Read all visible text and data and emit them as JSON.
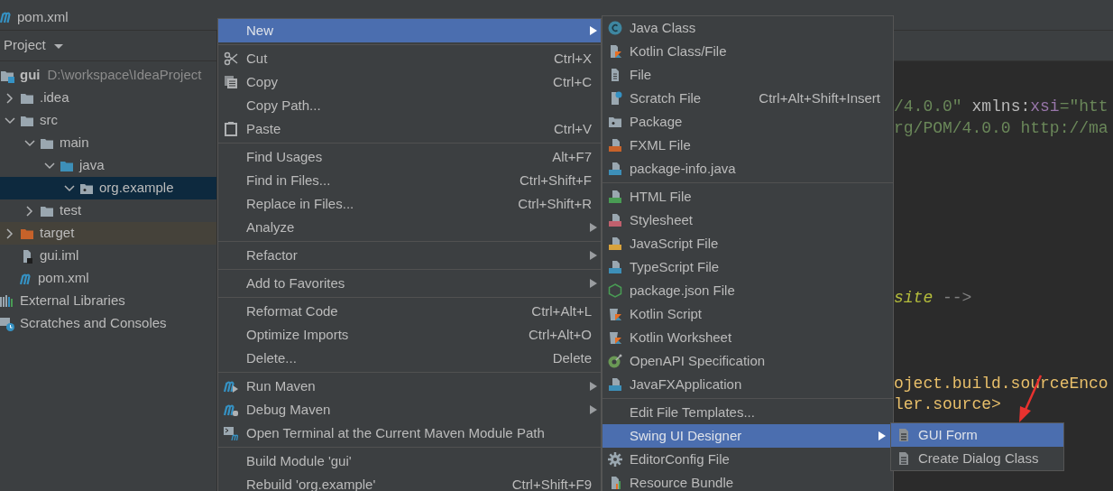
{
  "editor_tab": {
    "title": "pom.xml"
  },
  "project_panel": {
    "title": "Project",
    "tree": [
      {
        "label": "gui",
        "detail": "D:\\workspace\\IdeaProject",
        "kind": "module",
        "expanded": true,
        "selected": false,
        "children": [
          {
            "label": ".idea",
            "kind": "folder",
            "expanded": false,
            "selected": false
          },
          {
            "label": "src",
            "kind": "folder",
            "expanded": true,
            "selected": false,
            "children": [
              {
                "label": "main",
                "kind": "folder",
                "expanded": true,
                "selected": false,
                "children": [
                  {
                    "label": "java",
                    "kind": "source-folder",
                    "expanded": true,
                    "selected": false,
                    "children": [
                      {
                        "label": "org.example",
                        "kind": "package",
                        "expanded": true,
                        "selected": true
                      }
                    ]
                  }
                ]
              },
              {
                "label": "test",
                "kind": "folder",
                "expanded": false,
                "selected": false
              }
            ]
          },
          {
            "label": "target",
            "kind": "excluded-folder",
            "expanded": false,
            "selected": false
          },
          {
            "label": "gui.iml",
            "kind": "iml-file",
            "selected": false
          },
          {
            "label": "pom.xml",
            "kind": "maven-file",
            "selected": false
          }
        ]
      },
      {
        "label": "External Libraries",
        "kind": "libraries",
        "selected": false
      },
      {
        "label": "Scratches and Consoles",
        "kind": "scratches",
        "selected": false
      }
    ]
  },
  "code_lines": [
    {
      "segments": [
        {
          "kind": "string",
          "text": "/4.0.0\""
        },
        {
          "kind": "attr",
          "text": " xmlns:"
        },
        {
          "kind": "namespace",
          "text": "xsi"
        },
        {
          "kind": "string",
          "text": "=\"htt"
        }
      ]
    },
    {
      "segments": [
        {
          "kind": "string",
          "text": "rg/POM/4.0.0 http://ma"
        }
      ]
    },
    {
      "segments": [
        {
          "kind": "todo",
          "text": "site"
        },
        {
          "kind": "comment",
          "text": " -->"
        }
      ]
    },
    {
      "segments": [
        {
          "kind": "tag",
          "text": "oject.build.sourceEnco"
        }
      ]
    },
    {
      "segments": [
        {
          "kind": "tag",
          "text": "ler.source>"
        }
      ]
    }
  ],
  "context_menu": {
    "items": [
      {
        "kind": "plain",
        "label": "New",
        "submenu": true,
        "selected": true
      },
      {
        "kind": "separator"
      },
      {
        "kind": "cut",
        "label": "Cut",
        "shortcut": "Ctrl+X",
        "submenu": false,
        "selected": false
      },
      {
        "kind": "copy",
        "label": "Copy",
        "shortcut": "Ctrl+C",
        "submenu": false,
        "selected": false
      },
      {
        "kind": "plain",
        "label": "Copy Path...",
        "submenu": false,
        "selected": false
      },
      {
        "kind": "paste",
        "label": "Paste",
        "shortcut": "Ctrl+V",
        "submenu": false,
        "selected": false
      },
      {
        "kind": "separator"
      },
      {
        "kind": "plain",
        "label": "Find Usages",
        "shortcut": "Alt+F7",
        "submenu": false,
        "selected": false
      },
      {
        "kind": "plain",
        "label": "Find in Files...",
        "shortcut": "Ctrl+Shift+F",
        "submenu": false,
        "selected": false
      },
      {
        "kind": "plain",
        "label": "Replace in Files...",
        "shortcut": "Ctrl+Shift+R",
        "submenu": false,
        "selected": false
      },
      {
        "kind": "plain",
        "label": "Analyze",
        "submenu": true,
        "selected": false
      },
      {
        "kind": "separator"
      },
      {
        "kind": "plain",
        "label": "Refactor",
        "submenu": true,
        "selected": false
      },
      {
        "kind": "separator"
      },
      {
        "kind": "plain",
        "label": "Add to Favorites",
        "submenu": true,
        "selected": false
      },
      {
        "kind": "separator"
      },
      {
        "kind": "plain",
        "label": "Reformat Code",
        "shortcut": "Ctrl+Alt+L",
        "submenu": false,
        "selected": false
      },
      {
        "kind": "plain",
        "label": "Optimize Imports",
        "shortcut": "Ctrl+Alt+O",
        "submenu": false,
        "selected": false
      },
      {
        "kind": "plain",
        "label": "Delete...",
        "shortcut": "Delete",
        "submenu": false,
        "selected": false
      },
      {
        "kind": "separator"
      },
      {
        "kind": "run-maven",
        "label": "Run Maven",
        "submenu": true,
        "selected": false
      },
      {
        "kind": "debug-maven",
        "label": "Debug Maven",
        "submenu": true,
        "selected": false
      },
      {
        "kind": "terminal",
        "label": "Open Terminal at the Current Maven Module Path",
        "submenu": false,
        "selected": false
      },
      {
        "kind": "separator"
      },
      {
        "kind": "plain",
        "label": "Build Module 'gui'",
        "submenu": false,
        "selected": false
      },
      {
        "kind": "plain",
        "label": "Rebuild 'org.example'",
        "shortcut": "Ctrl+Shift+F9",
        "submenu": false,
        "selected": false
      }
    ]
  },
  "new_submenu": {
    "items": [
      {
        "kind": "java-class",
        "label": "Java Class",
        "submenu": false,
        "selected": false
      },
      {
        "kind": "kotlin",
        "label": "Kotlin Class/File",
        "submenu": false,
        "selected": false
      },
      {
        "kind": "file",
        "label": "File",
        "submenu": false,
        "selected": false
      },
      {
        "kind": "scratch",
        "label": "Scratch File",
        "shortcut": "Ctrl+Alt+Shift+Insert",
        "submenu": false,
        "selected": false
      },
      {
        "kind": "package",
        "label": "Package",
        "submenu": false,
        "selected": false
      },
      {
        "kind": "fxml",
        "label": "FXML File",
        "submenu": false,
        "selected": false
      },
      {
        "kind": "java-file",
        "label": "package-info.java",
        "submenu": false,
        "selected": false
      },
      {
        "kind": "separator"
      },
      {
        "kind": "html",
        "label": "HTML File",
        "submenu": false,
        "selected": false
      },
      {
        "kind": "css",
        "label": "Stylesheet",
        "submenu": false,
        "selected": false
      },
      {
        "kind": "js",
        "label": "JavaScript File",
        "submenu": false,
        "selected": false
      },
      {
        "kind": "ts",
        "label": "TypeScript File",
        "submenu": false,
        "selected": false
      },
      {
        "kind": "node",
        "label": "package.json File",
        "submenu": false,
        "selected": false
      },
      {
        "kind": "kotlin-script",
        "label": "Kotlin Script",
        "submenu": false,
        "selected": false
      },
      {
        "kind": "kotlin-script",
        "label": "Kotlin Worksheet",
        "submenu": false,
        "selected": false
      },
      {
        "kind": "openapi",
        "label": "OpenAPI Specification",
        "submenu": false,
        "selected": false
      },
      {
        "kind": "java-file",
        "label": "JavaFXApplication",
        "submenu": false,
        "selected": false
      },
      {
        "kind": "separator"
      },
      {
        "kind": "plain",
        "label": "Edit File Templates...",
        "submenu": false,
        "selected": false
      },
      {
        "kind": "plain",
        "label": "Swing UI Designer",
        "submenu": true,
        "selected": true
      },
      {
        "kind": "gear",
        "label": "EditorConfig File",
        "submenu": false,
        "selected": false
      },
      {
        "kind": "bundle",
        "label": "Resource Bundle",
        "submenu": false,
        "selected": false
      }
    ]
  },
  "swing_submenu": {
    "items": [
      {
        "kind": "form",
        "label": "GUI Form",
        "submenu": false,
        "selected": true
      },
      {
        "kind": "form",
        "label": "Create Dialog Class",
        "submenu": false,
        "selected": false
      }
    ]
  }
}
